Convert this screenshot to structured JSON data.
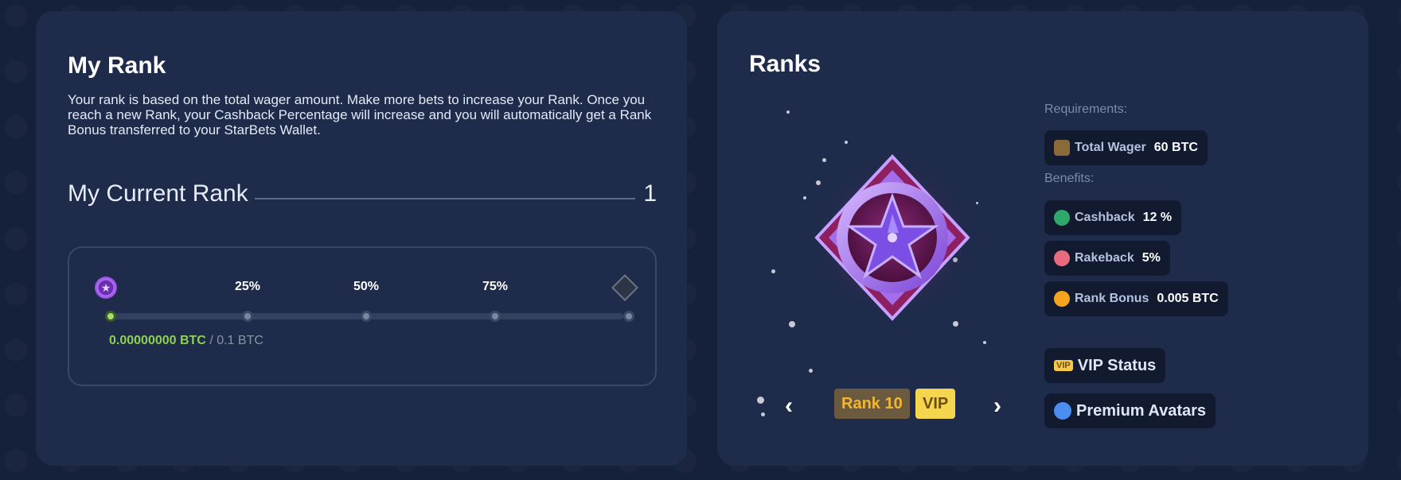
{
  "my_rank": {
    "title": "My Rank",
    "description": "Your rank is based on the total wager amount. Make more bets to increase your Rank. Once you reach a new Rank, your Cashback Percentage will increase and you will automatically get a Rank Bonus transferred to your StarBets Wallet.",
    "current_rank_label": "My Current Rank",
    "current_rank_value": "1",
    "progress": {
      "milestones": [
        "25%",
        "50%",
        "75%"
      ],
      "current_btc": "0.00000000 BTC",
      "target_btc": "/ 0.1 BTC",
      "fraction": 0.0
    }
  },
  "ranks": {
    "title": "Ranks",
    "selected_rank": "Rank 10",
    "vip_tag": "VIP",
    "requirements_label": "Requirements:",
    "requirements": [
      {
        "key": "Total Wager",
        "value": "60 BTC",
        "icon": "wager-icon"
      }
    ],
    "benefits_label": "Benefits:",
    "benefits": [
      {
        "key": "Cashback",
        "value": "12 %",
        "icon": "cashback-icon"
      },
      {
        "key": "Rakeback",
        "value": "5%",
        "icon": "rakeback-icon"
      },
      {
        "key": "Rank Bonus",
        "value": "0.005 BTC",
        "icon": "rank-bonus-icon"
      }
    ],
    "perks": [
      {
        "label": "VIP Status",
        "icon": "vip-icon",
        "icon_text": "VIP"
      },
      {
        "label": "Premium Avatars",
        "icon": "avatar-icon"
      }
    ],
    "prev_arrow": "‹",
    "next_arrow": "›"
  },
  "colors": {
    "panel": "#1e2b4a",
    "background": "#15203a",
    "accent_green": "#8ed14f",
    "gold": "#f3b633",
    "medal_purple": "#8a4fe0"
  }
}
